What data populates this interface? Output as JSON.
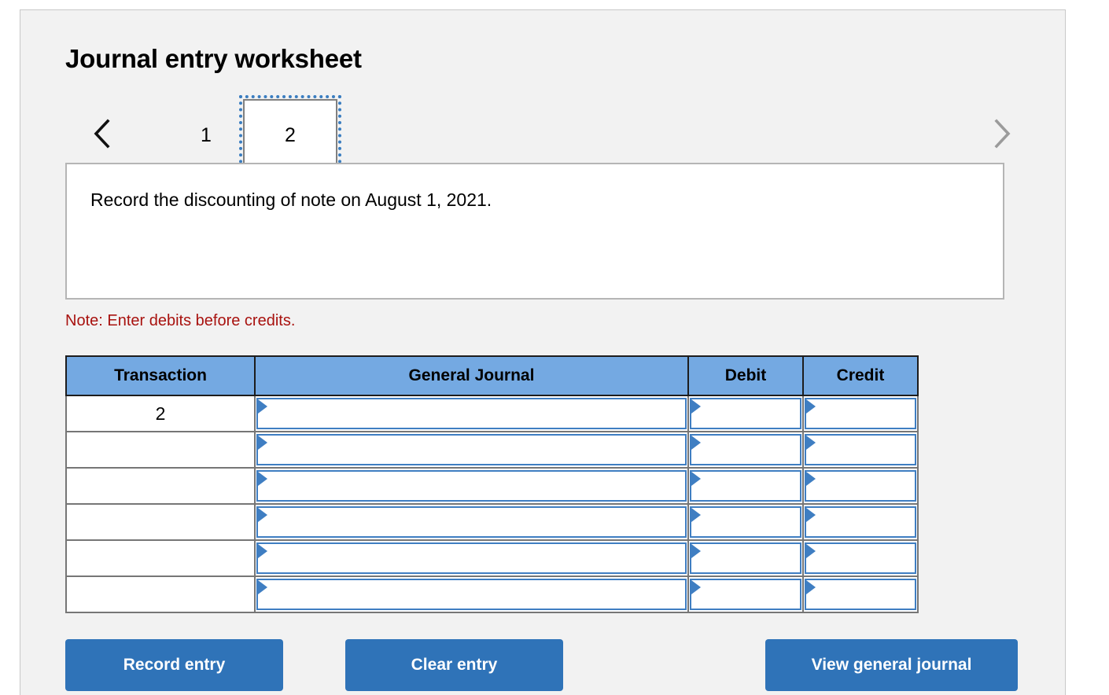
{
  "worksheet": {
    "title": "Journal entry worksheet"
  },
  "pager": {
    "prev_icon": "chevron-left-icon",
    "next_icon": "chevron-right-icon",
    "tabs": [
      {
        "label": "1",
        "selected": false
      },
      {
        "label": "2",
        "selected": true
      }
    ]
  },
  "description": {
    "text": "Record the discounting of note on August 1, 2021."
  },
  "note": {
    "text": "Note: Enter debits before credits."
  },
  "table": {
    "headers": {
      "transaction": "Transaction",
      "general_journal": "General Journal",
      "debit": "Debit",
      "credit": "Credit"
    },
    "rows": [
      {
        "transaction": "2",
        "general_journal": "",
        "debit": "",
        "credit": ""
      },
      {
        "transaction": "",
        "general_journal": "",
        "debit": "",
        "credit": ""
      },
      {
        "transaction": "",
        "general_journal": "",
        "debit": "",
        "credit": ""
      },
      {
        "transaction": "",
        "general_journal": "",
        "debit": "",
        "credit": ""
      },
      {
        "transaction": "",
        "general_journal": "",
        "debit": "",
        "credit": ""
      },
      {
        "transaction": "",
        "general_journal": "",
        "debit": "",
        "credit": ""
      }
    ]
  },
  "buttons": {
    "record_entry": "Record entry",
    "clear_entry": "Clear entry",
    "view_general_journal": "View general journal"
  },
  "colors": {
    "panel_bg": "#f2f2f2",
    "header_blue": "#74a9e2",
    "button_blue": "#2f73b8",
    "note_red": "#a8120f",
    "input_border_blue": "#3f7ec2",
    "focus_outline_blue": "#3a7dc0"
  }
}
